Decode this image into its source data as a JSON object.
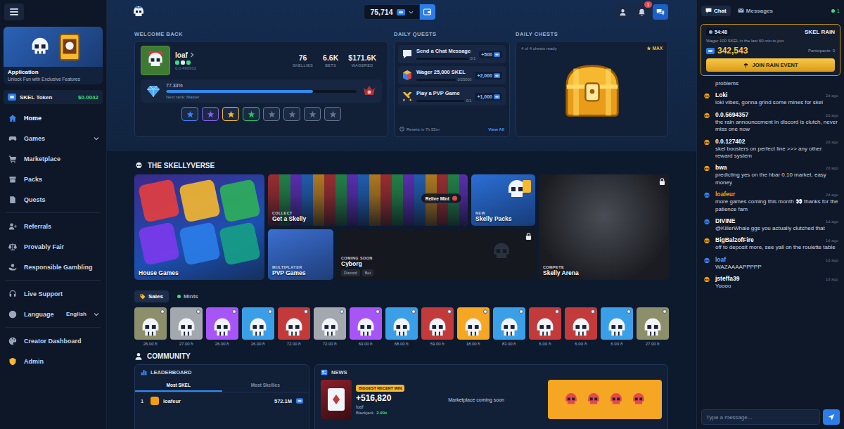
{
  "topbar": {
    "balance": "75,714",
    "notification_count": "1"
  },
  "sidebar": {
    "promo": {
      "title": "Application",
      "subtitle": "Unlock Fun with Exclusive Features"
    },
    "token": {
      "name": "SKEL Token",
      "price": "$0.0042"
    },
    "groups": [
      [
        {
          "label": "Home",
          "selected": true,
          "expandable": false,
          "color": "#3b82f6"
        },
        {
          "label": "Games",
          "selected": false,
          "expandable": true,
          "color": "#9aa8bd"
        },
        {
          "label": "Marketplace",
          "selected": false,
          "expandable": false,
          "color": "#9aa8bd"
        },
        {
          "label": "Packs",
          "selected": false,
          "expandable": false,
          "color": "#9aa8bd"
        },
        {
          "label": "Quests",
          "selected": false,
          "expandable": false,
          "color": "#9aa8bd"
        }
      ],
      [
        {
          "label": "Referrals",
          "selected": false,
          "expandable": false,
          "color": "#9aa8bd"
        },
        {
          "label": "Provably Fair",
          "selected": false,
          "expandable": false,
          "color": "#9aa8bd"
        },
        {
          "label": "Responsible Gambling",
          "selected": false,
          "expandable": false,
          "color": "#9aa8bd"
        }
      ],
      [
        {
          "label": "Live Support",
          "selected": false,
          "expandable": false,
          "color": "#9aa8bd"
        },
        {
          "label": "Language",
          "selected": false,
          "expandable": true,
          "value": "English",
          "color": "#9aa8bd"
        }
      ],
      [
        {
          "label": "Creator Dashboard",
          "selected": false,
          "expandable": false,
          "color": "#9aa8bd"
        },
        {
          "label": "Admin",
          "selected": false,
          "expandable": false,
          "color": "#f5b82e"
        }
      ]
    ]
  },
  "welcome": {
    "heading": "WELCOME BACK",
    "username": "loaf",
    "user_id": "0.0.490932",
    "stats": [
      {
        "value": "76",
        "label": "SKELLIES"
      },
      {
        "value": "6.6K",
        "label": "BETS"
      },
      {
        "value": "$171.6K",
        "label": "WAGERED"
      }
    ],
    "rank": {
      "percent": "77.33%",
      "level": 0.7733,
      "next": "Next rank: Master"
    },
    "badges": [
      {
        "color": "#3b82f6"
      },
      {
        "color": "#8b5cf6"
      },
      {
        "color": "#f5b82e"
      },
      {
        "color": "#22c55e"
      },
      {
        "color": "#64748b"
      },
      {
        "color": "#64748b"
      },
      {
        "color": "#64748b"
      },
      {
        "color": "#64748b"
      }
    ]
  },
  "quests": {
    "heading": "DAILY QUESTS",
    "items": [
      {
        "title": "Send a Chat Message",
        "progress": "0/1",
        "level": 0,
        "reward": "+500"
      },
      {
        "title": "Wager 25,000 SKEL",
        "progress": "0/25000",
        "level": 0,
        "reward": "+2,000"
      },
      {
        "title": "Play a PVP Game",
        "progress": "0/1",
        "level": 0,
        "reward": "+1,000"
      }
    ],
    "reset": "Resets in 7h 55m",
    "view_all": "View All"
  },
  "chests": {
    "heading": "DAILY CHESTS",
    "ready": "4 of 4 chests ready",
    "badge": "MAX"
  },
  "skellyverse": {
    "heading": "THE SKELLYVERSE",
    "tiles": [
      {
        "kind": "house",
        "title": "House Games",
        "tag": "",
        "locked": false
      },
      {
        "kind": "collect",
        "title": "Get a Skelly",
        "tag": "COLLECT",
        "locked": false,
        "button": "Relive Mint"
      },
      {
        "kind": "packs",
        "title": "Skelly Packs",
        "tag": "NEW",
        "locked": false
      },
      {
        "kind": "arena",
        "title": "Skelly Arena",
        "tag": "COMPETE",
        "locked": true
      },
      {
        "kind": "pvp",
        "title": "PVP Games",
        "tag": "MULTIPLAYER",
        "locked": false
      },
      {
        "kind": "cyborg",
        "title": "Cyborg",
        "tag": "COMING SOON",
        "locked": true,
        "links": [
          "Discord",
          "Bet"
        ]
      }
    ]
  },
  "market": {
    "tabs": [
      {
        "label": "Sales",
        "selected": true
      },
      {
        "label": "Mints",
        "selected": false
      }
    ],
    "items": [
      {
        "price": "26.00 ℏ",
        "color": "#8c8f6a"
      },
      {
        "price": "27.00 ℏ",
        "color": "#a3a8ae"
      },
      {
        "price": "26.00 ℏ",
        "color": "#a855f7"
      },
      {
        "price": "26.00 ℏ",
        "color": "#3b9fe8"
      },
      {
        "price": "72.00 ℏ",
        "color": "#c23a3a"
      },
      {
        "price": "72.00 ℏ",
        "color": "#a3a8ae"
      },
      {
        "price": "69.00 ℏ",
        "color": "#a855f7"
      },
      {
        "price": "68.00 ℏ",
        "color": "#3b9fe8"
      },
      {
        "price": "59.00 ℏ",
        "color": "#c23a3a"
      },
      {
        "price": "18.00 ℏ",
        "color": "#f5a623"
      },
      {
        "price": "83.00 ℏ",
        "color": "#3b9fe8"
      },
      {
        "price": "6.00 ℏ",
        "color": "#c23a3a"
      },
      {
        "price": "6.00 ℏ",
        "color": "#c23a3a"
      },
      {
        "price": "6.00 ℏ",
        "color": "#3b9fe8"
      },
      {
        "price": "27.00 ℏ",
        "color": "#8c8f6a"
      }
    ]
  },
  "community": {
    "heading": "COMMUNITY",
    "leaderboard": {
      "title": "LEADERBOARD",
      "tabs": [
        {
          "label": "Most SKEL",
          "selected": true
        },
        {
          "label": "Most Skellies",
          "selected": false
        }
      ],
      "rows": [
        {
          "rank": "1",
          "name": "loafeur",
          "value": "572.1M"
        }
      ]
    },
    "news": {
      "title": "NEWS",
      "win": {
        "badge": "BIGGEST RECENT WIN",
        "amount": "+516,820",
        "user": "loaf",
        "game": "Blackjack",
        "multiplier": "2.00x"
      },
      "notice": "Marketplace coming soon"
    }
  },
  "chat": {
    "tabs": [
      {
        "label": "Chat",
        "selected": true
      },
      {
        "label": "Messages",
        "selected": false
      }
    ],
    "online": "1",
    "rain": {
      "timer": "54:48",
      "title": "SKEL RAIN",
      "hint": "Wager 100 SKEL in the last 60 min to join",
      "amount": "342,543",
      "participants": "Participants: 0",
      "button": "JOIN RAIN EVENT"
    },
    "messages": [
      {
        "kind": "fragment",
        "user": "",
        "time": "",
        "text": "problems",
        "color": "#ffffff",
        "avatar_color": "#f59e0b"
      },
      {
        "kind": "message",
        "user": "Loki",
        "time": "2d ago",
        "text": "loki vibes, gonna grind some mines for skel",
        "color": "#ffffff",
        "avatar_color": "#f59e0b"
      },
      {
        "kind": "message",
        "user": "0.0.5694357",
        "time": "2d ago",
        "text": "the rain announcement in discord is clutch, never miss one now",
        "color": "#ffffff",
        "avatar_color": "#f59e0b"
      },
      {
        "kind": "message",
        "user": "0.0.127402",
        "time": "2d ago",
        "text": "skel boosters on perfect line >>> any other reward system",
        "color": "#ffffff",
        "avatar_color": "#f59e0b"
      },
      {
        "kind": "message",
        "user": "bwa",
        "time": "2d ago",
        "text": "predicting yes on the hbar 0.10 market, easy money",
        "color": "#ffffff",
        "avatar_color": "#f59e0b"
      },
      {
        "kind": "message",
        "user": "loafeur",
        "time": "2d ago",
        "text": "more games coming this month 👀 thanks for the patience fam",
        "color": "#f59e0b",
        "avatar_color": "#3b82f6"
      },
      {
        "kind": "message",
        "user": "DIVINE",
        "time": "1d ago",
        "text": "@KillerWhale ggs you actually clutched that",
        "color": "#ffffff",
        "avatar_color": "#3b82f6"
      },
      {
        "kind": "message",
        "user": "BigBalzofFire",
        "time": "1d ago",
        "text": "off to deposit more, see yall on the roulette table",
        "color": "#ffffff",
        "avatar_color": "#f59e0b"
      },
      {
        "kind": "message",
        "user": "loaf",
        "time": "1d ago",
        "text": "WAZAAAAPPPPP",
        "color": "#60a5fa",
        "avatar_color": "#3b82f6"
      },
      {
        "kind": "message",
        "user": "jsteffa39",
        "time": "1d ago",
        "text": "Yoooo",
        "color": "#ffffff",
        "avatar_color": "#f59e0b"
      }
    ],
    "input": {
      "placeholder": "Type a message..."
    }
  }
}
